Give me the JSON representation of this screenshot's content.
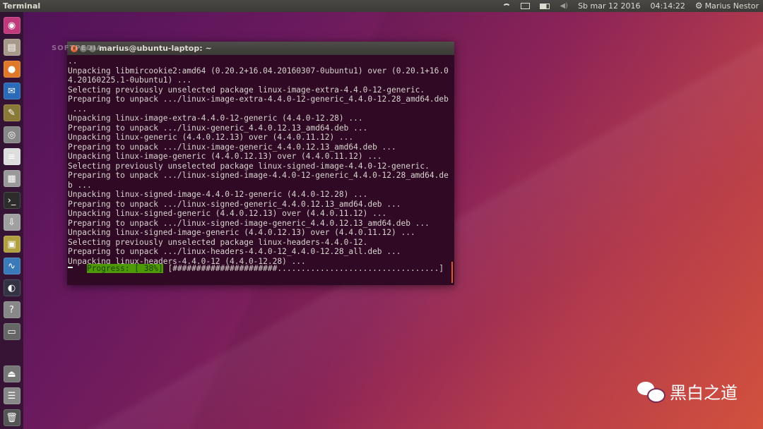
{
  "top_panel": {
    "app_title": "Terminal",
    "datetime": "Sb mar 12 2016",
    "time": "04:14:22",
    "user": "Marius Nestor"
  },
  "launcher": {
    "items": [
      {
        "icon": "ubuntu-dash-icon",
        "glyph": "◉",
        "color": "#c0397c"
      },
      {
        "icon": "files-icon",
        "glyph": "▤",
        "color": "#a89a8a"
      },
      {
        "icon": "firefox-icon",
        "glyph": "●",
        "color": "#e0782a"
      },
      {
        "icon": "thunderbird-icon",
        "glyph": "✉",
        "color": "#2a6ab8"
      },
      {
        "icon": "gimp-icon",
        "glyph": "✎",
        "color": "#8a7a3a"
      },
      {
        "icon": "screenshot-icon",
        "glyph": "◎",
        "color": "#888888"
      },
      {
        "icon": "text-editor-icon",
        "glyph": "≡",
        "color": "#dddddd"
      },
      {
        "icon": "calculator-icon",
        "glyph": "▦",
        "color": "#999999"
      },
      {
        "icon": "terminal-icon",
        "glyph": "›_",
        "color": "#2c2c2c"
      },
      {
        "icon": "install-icon",
        "glyph": "⇩",
        "color": "#a0a0a0"
      },
      {
        "icon": "archive-icon",
        "glyph": "▣",
        "color": "#b0a040"
      },
      {
        "icon": "system-monitor-icon",
        "glyph": "∿",
        "color": "#3a7ab8"
      },
      {
        "icon": "steam-icon",
        "glyph": "◐",
        "color": "#333344"
      },
      {
        "icon": "help-icon",
        "glyph": "?",
        "color": "#888888"
      },
      {
        "icon": "drive-icon",
        "glyph": "▭",
        "color": "#666666"
      }
    ],
    "bottom_items": [
      {
        "icon": "removable-drive-icon",
        "glyph": "⏏",
        "color": "#777777"
      },
      {
        "icon": "hard-drive-icon",
        "glyph": "☰",
        "color": "#888888"
      },
      {
        "icon": "trash-icon",
        "glyph": "🗑",
        "color": "#555555"
      }
    ]
  },
  "terminal": {
    "title": "marius@ubuntu-laptop: ~",
    "watermark": "SOFTPEDIA",
    "lines": [
      "..",
      "Unpacking libmircookie2:amd64 (0.20.2+16.04.20160307-0ubuntu1) over (0.20.1+16.0",
      "4.20160225.1-0ubuntu1) ...",
      "Selecting previously unselected package linux-image-extra-4.4.0-12-generic.",
      "Preparing to unpack .../linux-image-extra-4.4.0-12-generic_4.4.0-12.28_amd64.deb",
      " ...",
      "Unpacking linux-image-extra-4.4.0-12-generic (4.4.0-12.28) ...",
      "Preparing to unpack .../linux-generic_4.4.0.12.13_amd64.deb ...",
      "Unpacking linux-generic (4.4.0.12.13) over (4.4.0.11.12) ...",
      "Preparing to unpack .../linux-image-generic_4.4.0.12.13_amd64.deb ...",
      "Unpacking linux-image-generic (4.4.0.12.13) over (4.4.0.11.12) ...",
      "Selecting previously unselected package linux-signed-image-4.4.0-12-generic.",
      "Preparing to unpack .../linux-signed-image-4.4.0-12-generic_4.4.0-12.28_amd64.de",
      "b ...",
      "Unpacking linux-signed-image-4.4.0-12-generic (4.4.0-12.28) ...",
      "Preparing to unpack .../linux-signed-generic_4.4.0.12.13_amd64.deb ...",
      "Unpacking linux-signed-generic (4.4.0.12.13) over (4.4.0.11.12) ...",
      "Preparing to unpack .../linux-signed-image-generic_4.4.0.12.13_amd64.deb ...",
      "Unpacking linux-signed-image-generic (4.4.0.12.13) over (4.4.0.11.12) ...",
      "Selecting previously unselected package linux-headers-4.4.0-12.",
      "Preparing to unpack .../linux-headers-4.4.0-12_4.4.0-12.28_all.deb ...",
      "Unpacking linux-headers-4.4.0-12 (4.4.0-12.28) ..."
    ],
    "progress_label": "Progress: [ 38%]",
    "progress_bar": " [######################..................................]",
    "progress_value": 0.38
  },
  "badge": {
    "text": "黑白之道",
    "icon": "wechat-icon"
  }
}
